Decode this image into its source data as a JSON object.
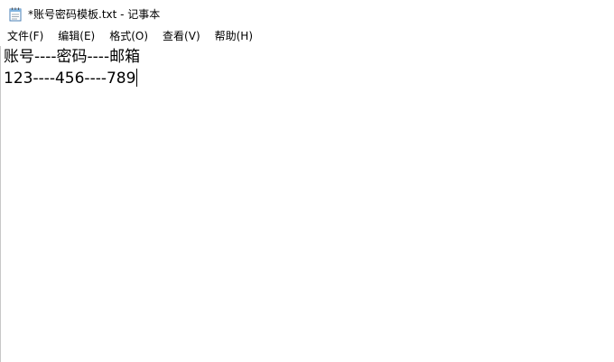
{
  "window": {
    "title": "*账号密码模板.txt - 记事本",
    "app_icon": "notepad-icon"
  },
  "menu": {
    "items": [
      {
        "label": "文件(F)"
      },
      {
        "label": "编辑(E)"
      },
      {
        "label": "格式(O)"
      },
      {
        "label": "查看(V)"
      },
      {
        "label": "帮助(H)"
      }
    ]
  },
  "document": {
    "lines": [
      "账号----密码----邮箱",
      "123----456----789"
    ]
  }
}
